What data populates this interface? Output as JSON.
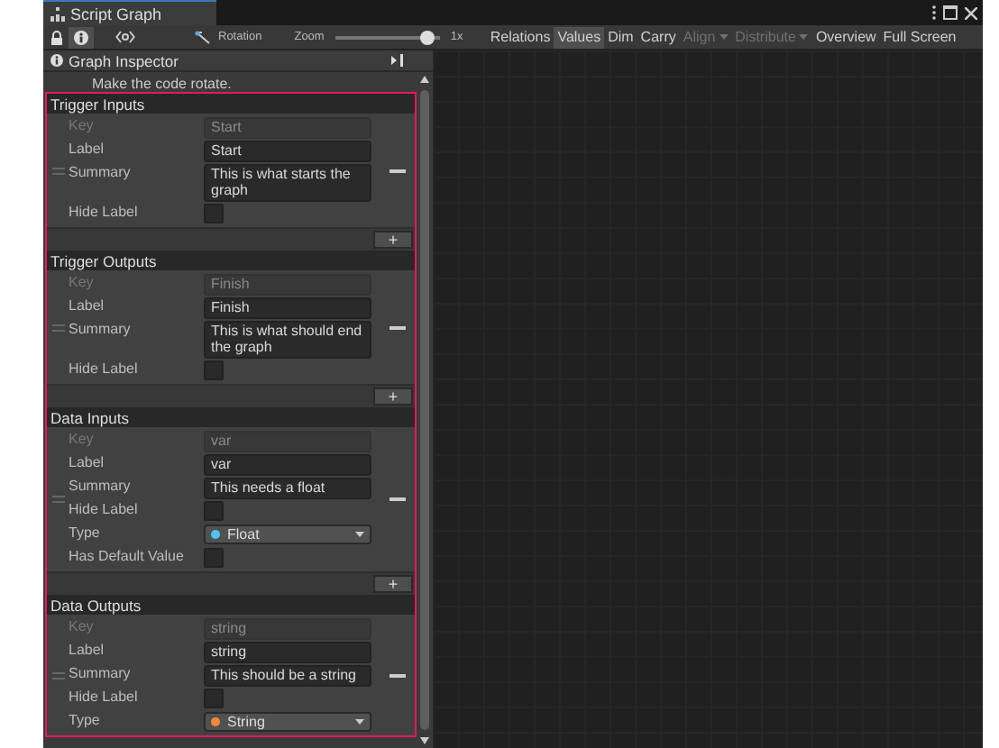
{
  "window": {
    "tab_title": "Script Graph"
  },
  "toolbar": {
    "lock_selected": false,
    "info_selected": true,
    "rotation_label": "Rotation",
    "zoom_label": "Zoom",
    "zoom": {
      "level": 0.95
    },
    "zoom_reading": "1x",
    "toggles": [
      {
        "label": "Relations",
        "selected": false,
        "disabled": false,
        "dropdown": false
      },
      {
        "label": "Values",
        "selected": true,
        "disabled": false,
        "dropdown": false
      },
      {
        "label": "Dim",
        "selected": false,
        "disabled": false,
        "dropdown": false
      },
      {
        "label": "Carry",
        "selected": false,
        "disabled": false,
        "dropdown": false
      },
      {
        "label": "Align",
        "selected": false,
        "disabled": true,
        "dropdown": true
      },
      {
        "label": "Distribute",
        "selected": false,
        "disabled": true,
        "dropdown": true
      },
      {
        "label": "Overview",
        "selected": false,
        "disabled": false,
        "dropdown": false
      },
      {
        "label": "Full Screen",
        "selected": false,
        "disabled": false,
        "dropdown": false
      }
    ]
  },
  "inspector": {
    "title": "Graph Inspector",
    "description": "Make the code rotate.",
    "sections": [
      {
        "title": "Trigger Inputs",
        "add_label": "+",
        "rows": [
          {
            "kind": "key",
            "label": "Key",
            "value": "Start"
          },
          {
            "kind": "text",
            "label": "Label",
            "value": "Start"
          },
          {
            "kind": "text",
            "label": "Summary",
            "value": "This is what starts the graph"
          },
          {
            "kind": "checkbox",
            "label": "Hide Label",
            "checked": false
          }
        ]
      },
      {
        "title": "Trigger Outputs",
        "add_label": "+",
        "rows": [
          {
            "kind": "key",
            "label": "Key",
            "value": "Finish"
          },
          {
            "kind": "text",
            "label": "Label",
            "value": "Finish"
          },
          {
            "kind": "text",
            "label": "Summary",
            "value": "This is what should end the graph"
          },
          {
            "kind": "checkbox",
            "label": "Hide Label",
            "checked": false
          }
        ]
      },
      {
        "title": "Data Inputs",
        "add_label": "+",
        "rows": [
          {
            "kind": "key",
            "label": "Key",
            "value": "var"
          },
          {
            "kind": "text",
            "label": "Label",
            "value": "var"
          },
          {
            "kind": "text",
            "label": "Summary",
            "value": "This needs a float"
          },
          {
            "kind": "checkbox",
            "label": "Hide Label",
            "checked": false
          },
          {
            "kind": "dropdown",
            "label": "Type",
            "value": "Float",
            "color": "#4fc3f7"
          },
          {
            "kind": "checkbox",
            "label": "Has Default Value",
            "checked": false
          }
        ]
      },
      {
        "title": "Data Outputs",
        "rows": [
          {
            "kind": "key",
            "label": "Key",
            "value": "string"
          },
          {
            "kind": "text",
            "label": "Label",
            "value": "string"
          },
          {
            "kind": "text",
            "label": "Summary",
            "value": "This should be a string"
          },
          {
            "kind": "checkbox",
            "label": "Hide Label",
            "checked": false
          },
          {
            "kind": "dropdown",
            "label": "Type",
            "value": "String",
            "color": "#f5883a"
          }
        ]
      }
    ]
  }
}
